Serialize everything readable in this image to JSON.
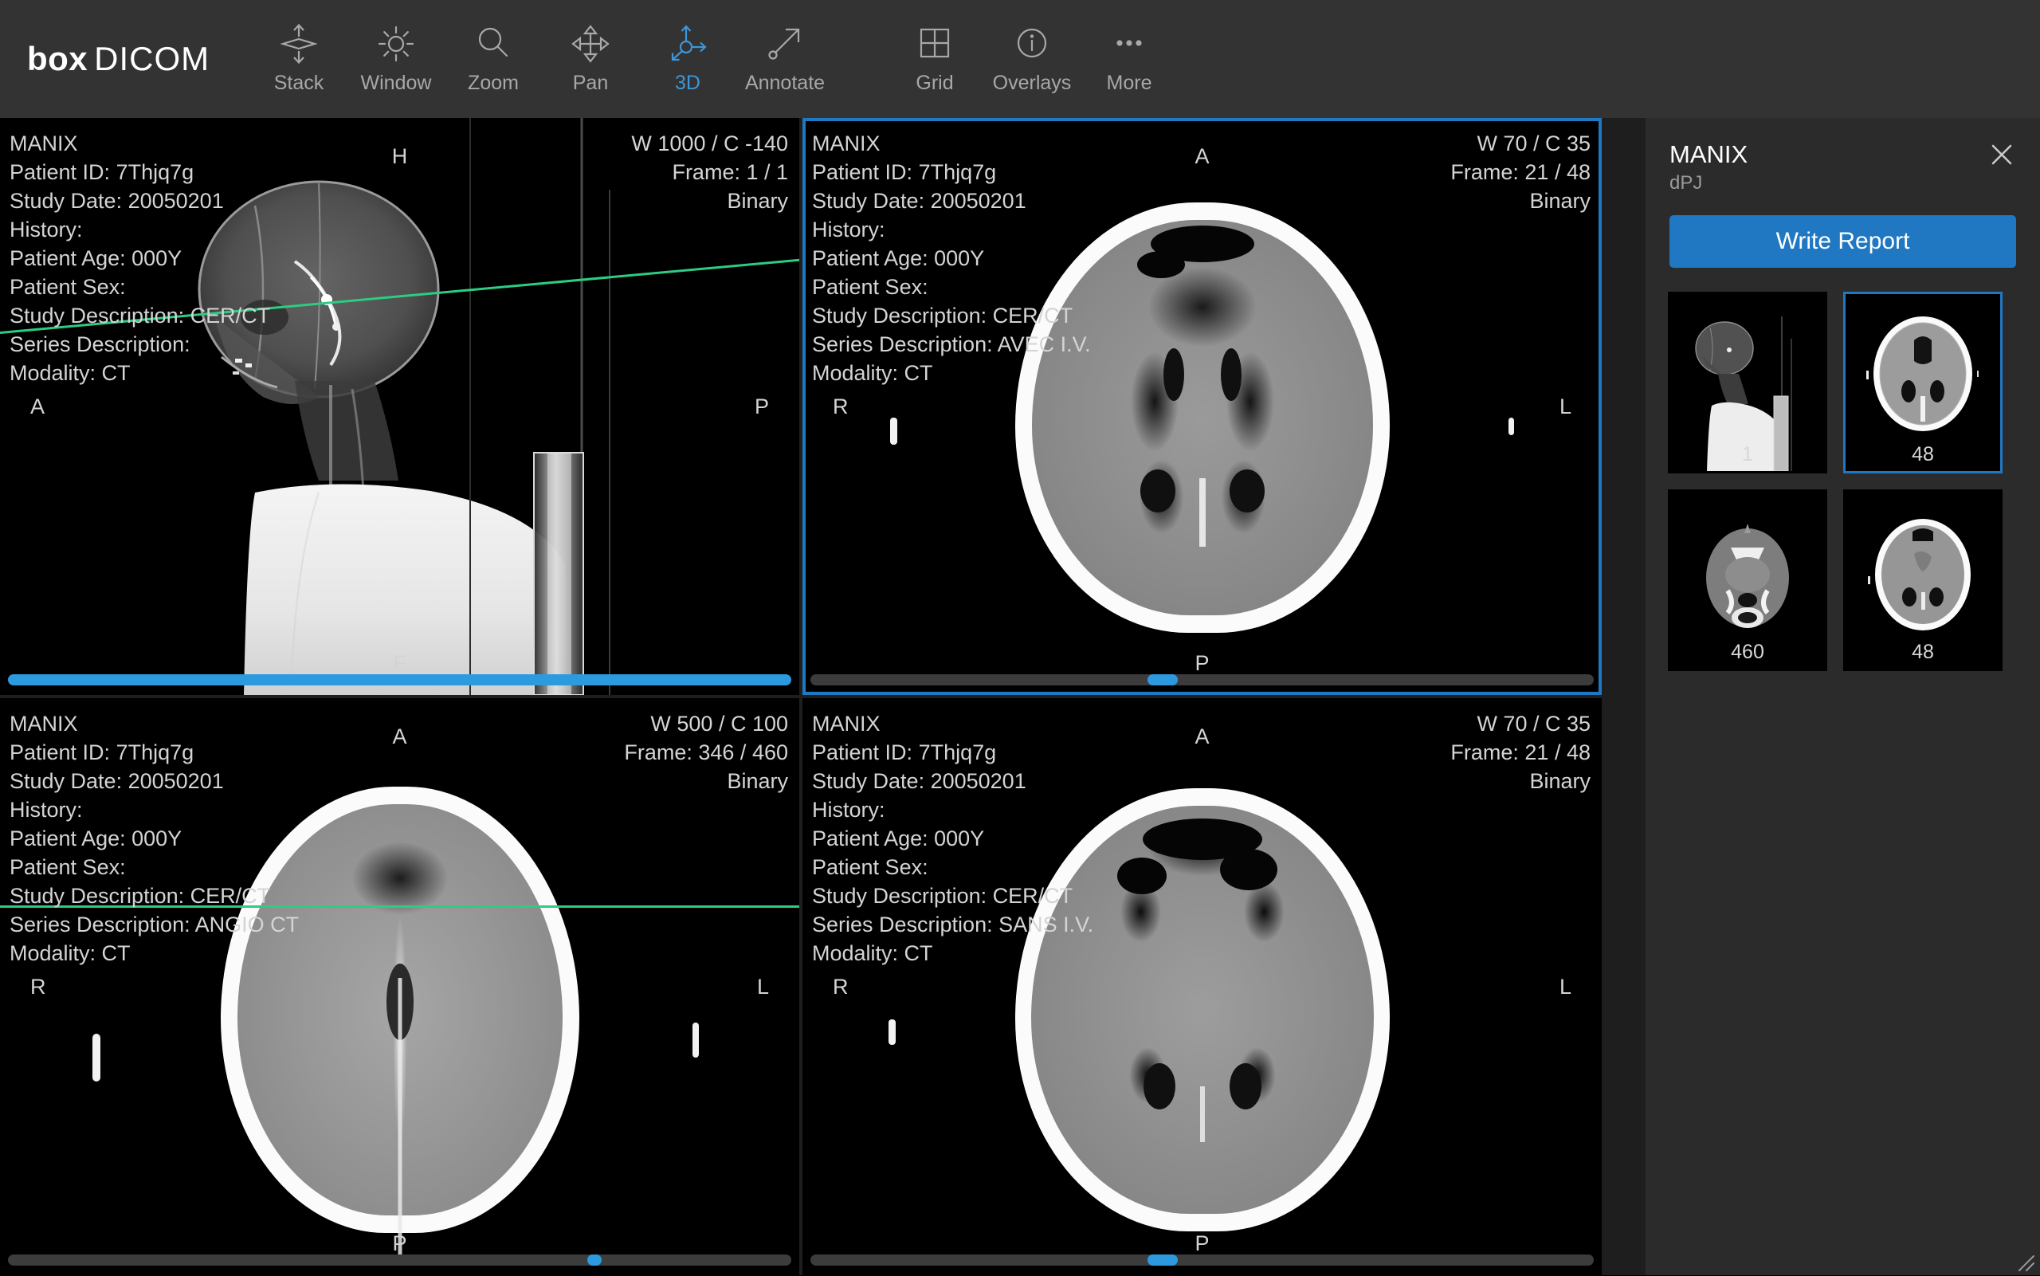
{
  "app": {
    "brand_bold": "box",
    "brand_light": "DICOM"
  },
  "toolbar": {
    "items": [
      {
        "label": "Stack",
        "icon": "stack-icon",
        "active": false
      },
      {
        "label": "Window",
        "icon": "window-icon",
        "active": false
      },
      {
        "label": "Zoom",
        "icon": "zoom-icon",
        "active": false
      },
      {
        "label": "Pan",
        "icon": "pan-icon",
        "active": false
      },
      {
        "label": "3D",
        "icon": "crosshair-3d-icon",
        "active": true
      },
      {
        "label": "Annotate",
        "icon": "annotate-icon",
        "active": false
      },
      {
        "label": "Grid",
        "icon": "grid-icon",
        "active": false
      },
      {
        "label": "Overlays",
        "icon": "info-icon",
        "active": false
      },
      {
        "label": "More",
        "icon": "more-icon",
        "active": false
      }
    ],
    "active_color": "#3d96d8",
    "inactive_color": "#a8a8a8"
  },
  "viewports": [
    {
      "id": "top-left",
      "selected": false,
      "patient_name": "MANIX",
      "patient_id": "Patient ID: 7Thjq7g",
      "study_date": "Study Date: 20050201",
      "history": "History:",
      "patient_age": "Patient Age: 000Y",
      "patient_sex": "Patient Sex:",
      "study_description": "Study Description: CER/CT",
      "series_description": "Series Description:",
      "modality": "Modality: CT",
      "window": "W 1000 / C -140",
      "frame": "Frame: 1 / 1",
      "transfer": "Binary",
      "orient_top": "H",
      "orient_bottom": "F",
      "orient_left": "A",
      "orient_right": "P",
      "scroll_percent": 100,
      "scroll_full": true
    },
    {
      "id": "top-right",
      "selected": true,
      "patient_name": "MANIX",
      "patient_id": "Patient ID: 7Thjq7g",
      "study_date": "Study Date: 20050201",
      "history": "History:",
      "patient_age": "Patient Age: 000Y",
      "patient_sex": "Patient Sex:",
      "study_description": "Study Description: CER/CT",
      "series_description": "Series Description: AVEC I.V.",
      "modality": "Modality: CT",
      "window": "W 70 / C 35",
      "frame": "Frame: 21 / 48",
      "transfer": "Binary",
      "orient_top": "A",
      "orient_bottom": "P",
      "orient_left": "R",
      "orient_right": "L",
      "scroll_percent": 43,
      "scroll_full": false
    },
    {
      "id": "bottom-left",
      "selected": false,
      "patient_name": "MANIX",
      "patient_id": "Patient ID: 7Thjq7g",
      "study_date": "Study Date: 20050201",
      "history": "History:",
      "patient_age": "Patient Age: 000Y",
      "patient_sex": "Patient Sex:",
      "study_description": "Study Description: CER/CT",
      "series_description": "Series Description: ANGIO CT",
      "modality": "Modality: CT",
      "window": "W 500 / C 100",
      "frame": "Frame: 346 / 460",
      "transfer": "Binary",
      "orient_top": "A",
      "orient_bottom": "P",
      "orient_left": "R",
      "orient_right": "L",
      "scroll_percent": 75,
      "scroll_full": false
    },
    {
      "id": "bottom-right",
      "selected": false,
      "patient_name": "MANIX",
      "patient_id": "Patient ID: 7Thjq7g",
      "study_date": "Study Date: 20050201",
      "history": "History:",
      "patient_age": "Patient Age: 000Y",
      "patient_sex": "Patient Sex:",
      "study_description": "Study Description: CER/CT",
      "series_description": "Series Description: SANS I.V.",
      "modality": "Modality: CT",
      "window": "W 70 / C 35",
      "frame": "Frame: 21 / 48",
      "transfer": "Binary",
      "orient_top": "A",
      "orient_bottom": "P",
      "orient_left": "R",
      "orient_right": "L",
      "scroll_percent": 43,
      "scroll_full": false
    }
  ],
  "panel": {
    "title": "MANIX",
    "subtitle": "dPJ",
    "write_report_label": "Write Report",
    "close_icon": "close-icon",
    "thumbnails": [
      {
        "number": "1",
        "kind": "scout",
        "selected": false
      },
      {
        "number": "48",
        "kind": "axial-upper",
        "selected": true
      },
      {
        "number": "460",
        "kind": "neck",
        "selected": false
      },
      {
        "number": "48",
        "kind": "axial-lower",
        "selected": false
      }
    ]
  },
  "colors": {
    "accent": "#1f78c1",
    "scrollbar": "#2d9ae0",
    "reference_line": "#2ecc83",
    "toolbar_bg": "#333333",
    "panel_bg": "#2b2b2b",
    "viewport_bg": "#000000",
    "overlay_text": "#d4d4d4"
  }
}
